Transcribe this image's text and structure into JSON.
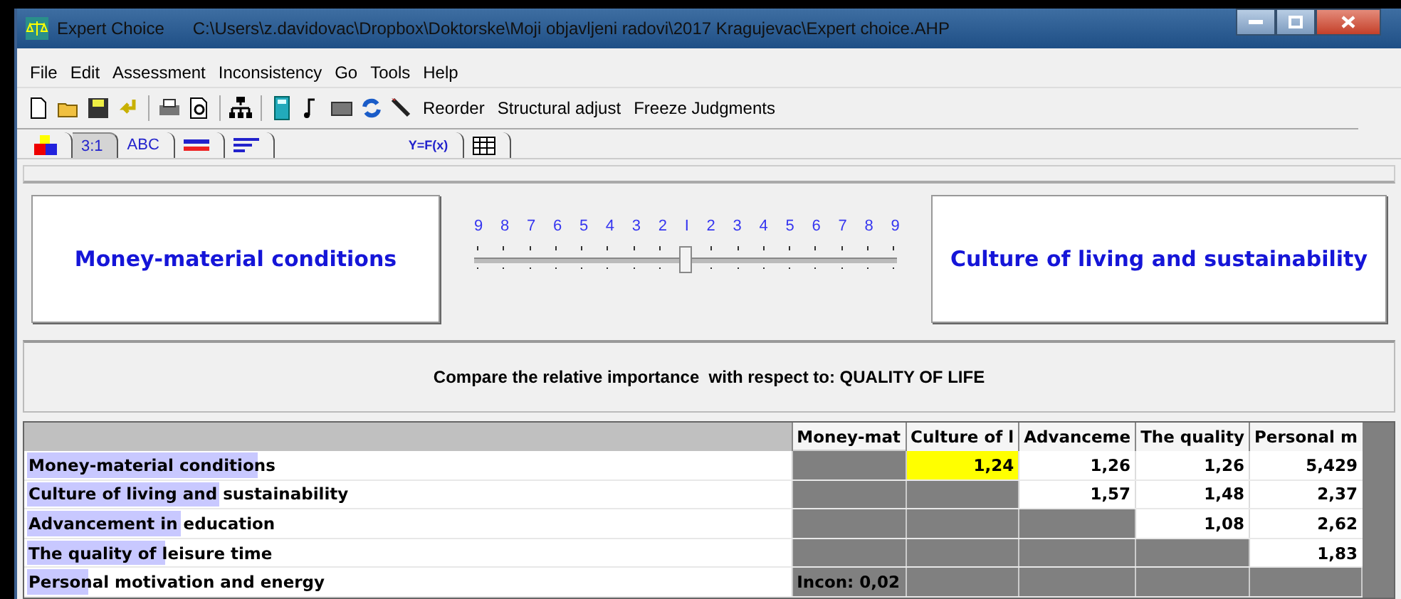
{
  "window": {
    "app": "Expert Choice",
    "path": "C:\\Users\\z.davidovac\\Dropbox\\Doktorske\\Moji objavljeni radovi\\2017 Kragujevac\\Expert choice.AHP"
  },
  "menu": [
    "File",
    "Edit",
    "Assessment",
    "Inconsistency",
    "Go",
    "Tools",
    "Help"
  ],
  "toolbar": {
    "buttons": [
      "Reorder",
      "Structural adjust",
      "Freeze Judgments"
    ]
  },
  "tabs": [
    {
      "kind": "icon",
      "selected": false
    },
    {
      "kind": "text",
      "label": "3:1",
      "selected": true
    },
    {
      "kind": "text",
      "label": "ABC",
      "selected": false
    },
    {
      "kind": "icon",
      "selected": false
    },
    {
      "kind": "icon",
      "selected": false
    },
    {
      "kind": "text",
      "label": "Y=F(x)",
      "selected": false
    },
    {
      "kind": "icon",
      "selected": false
    }
  ],
  "compare": {
    "left": "Money-material conditions",
    "right": "Culture of living and sustainability",
    "scale": [
      "9",
      "8",
      "7",
      "6",
      "5",
      "4",
      "3",
      "2",
      "I",
      "2",
      "3",
      "4",
      "5",
      "6",
      "7",
      "8",
      "9"
    ],
    "level": 0.5
  },
  "prompt": "Compare the relative importance  with respect to: QUALITY OF LIFE",
  "matrix": {
    "columns": [
      "Money-mat",
      "Culture of l",
      "Advanceme",
      "The quality",
      "Personal m"
    ],
    "rows": [
      {
        "name": "Money-material conditions",
        "level": 0.3,
        "cells": [
          {
            "kind": "blank"
          },
          {
            "kind": "value",
            "text": "1,24",
            "selected": true
          },
          {
            "kind": "value",
            "text": "1,26",
            "selected": false
          },
          {
            "kind": "value",
            "text": "1,26",
            "selected": false
          },
          {
            "kind": "value",
            "text": "5,429",
            "selected": false
          }
        ]
      },
      {
        "name": "Culture of living and sustainability",
        "level": 0.25,
        "cells": [
          {
            "kind": "blank"
          },
          {
            "kind": "blank"
          },
          {
            "kind": "value",
            "text": "1,57",
            "selected": false
          },
          {
            "kind": "value",
            "text": "1,48",
            "selected": false
          },
          {
            "kind": "value",
            "text": "2,37",
            "selected": false
          }
        ]
      },
      {
        "name": "Advancement in education",
        "level": 0.2,
        "cells": [
          {
            "kind": "blank"
          },
          {
            "kind": "blank"
          },
          {
            "kind": "blank"
          },
          {
            "kind": "value",
            "text": "1,08",
            "selected": false
          },
          {
            "kind": "value",
            "text": "2,62",
            "selected": false
          }
        ]
      },
      {
        "name": "The quality of leisure time",
        "level": 0.18,
        "cells": [
          {
            "kind": "blank"
          },
          {
            "kind": "blank"
          },
          {
            "kind": "blank"
          },
          {
            "kind": "blank"
          },
          {
            "kind": "value",
            "text": "1,83",
            "selected": false
          }
        ]
      },
      {
        "name": "Personal motivation and energy",
        "level": 0.08,
        "cells": [
          {
            "kind": "note",
            "text": "Incon: 0,02"
          },
          {
            "kind": "blank"
          },
          {
            "kind": "blank"
          },
          {
            "kind": "blank"
          },
          {
            "kind": "blank"
          }
        ]
      }
    ]
  }
}
